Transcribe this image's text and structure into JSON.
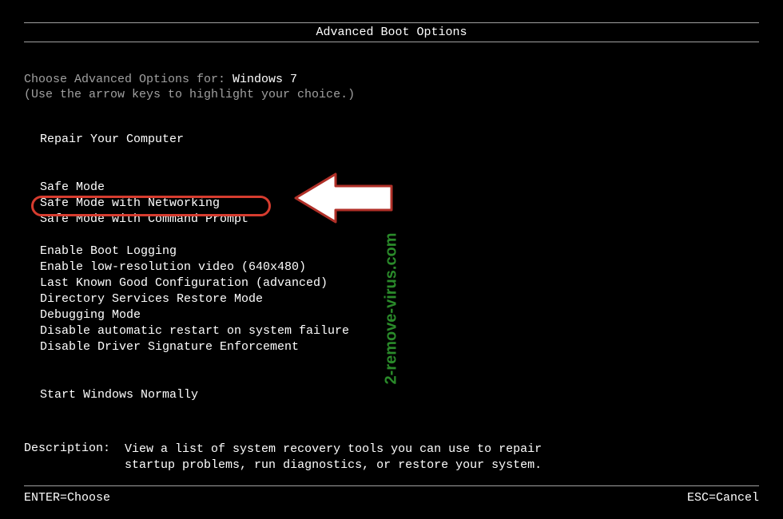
{
  "title": "Advanced Boot Options",
  "instruction_prefix": "Choose Advanced Options for: ",
  "os_name": "Windows 7",
  "hint": "(Use the arrow keys to highlight your choice.)",
  "menu": {
    "repair": "Repair Your Computer",
    "safe_mode": "Safe Mode",
    "safe_mode_net": "Safe Mode with Networking",
    "safe_mode_cmd": "Safe Mode with Command Prompt",
    "boot_logging": "Enable Boot Logging",
    "low_res": "Enable low-resolution video (640x480)",
    "last_known": "Last Known Good Configuration (advanced)",
    "ds_restore": "Directory Services Restore Mode",
    "debug": "Debugging Mode",
    "no_restart": "Disable automatic restart on system failure",
    "no_driver_sig": "Disable Driver Signature Enforcement",
    "start_normal": "Start Windows Normally"
  },
  "description": {
    "label": "Description:",
    "text_line1": "View a list of system recovery tools you can use to repair",
    "text_line2": "startup problems, run diagnostics, or restore your system."
  },
  "footer": {
    "enter": "ENTER=Choose",
    "esc": "ESC=Cancel"
  },
  "watermark": "2-remove-virus.com",
  "highlighted_item": "safe_mode_cmd",
  "colors": {
    "background": "#000000",
    "text_dim": "#a0a0a0",
    "text_bright": "#ffffff",
    "highlight_border": "#d63c2f",
    "arrow_fill": "#ffffff",
    "watermark": "#2a8a2a"
  }
}
